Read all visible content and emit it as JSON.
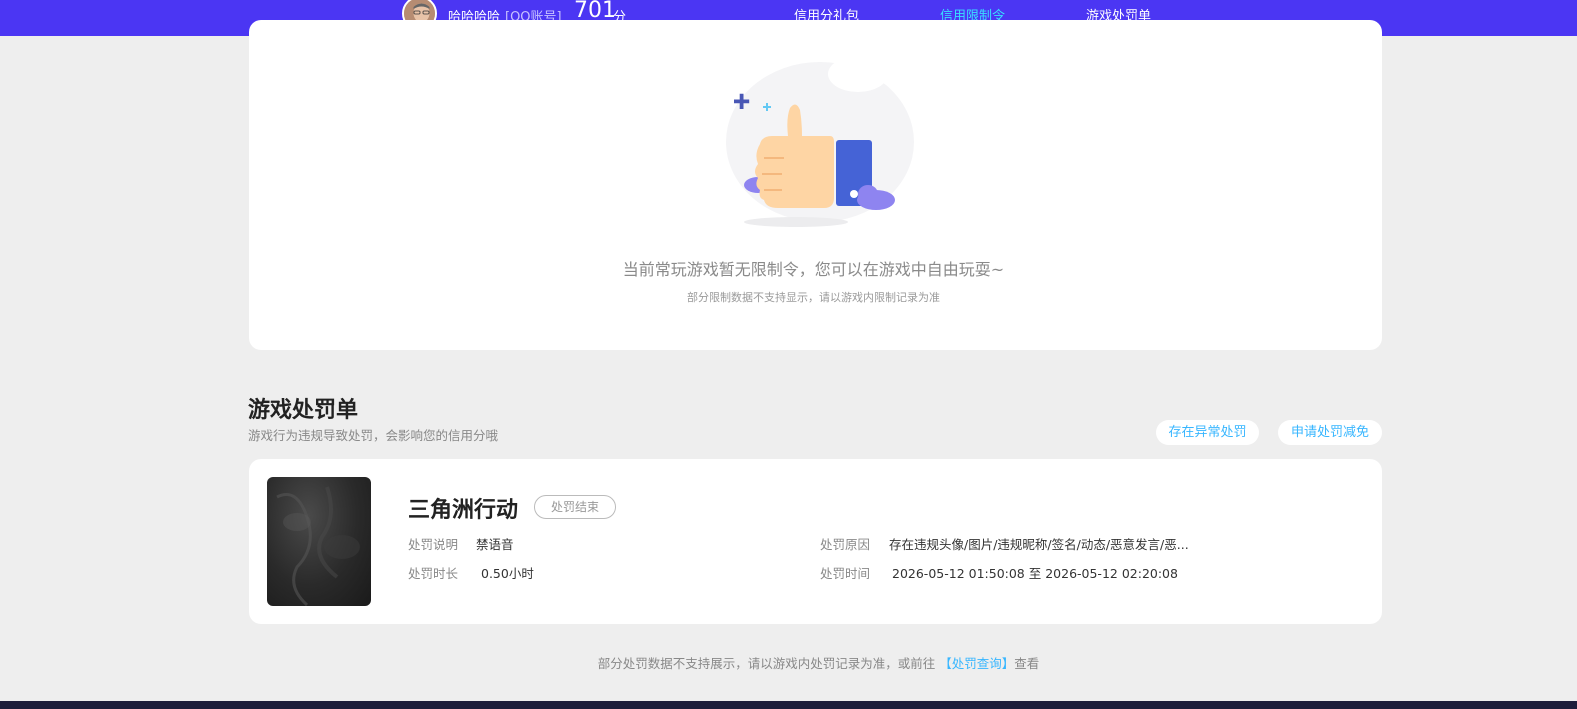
{
  "header": {
    "username": "哈哈哈哈",
    "account_type": "[QQ账号]",
    "score": "701",
    "score_unit": "分",
    "nav": [
      {
        "label": "信用分礼包",
        "active": false
      },
      {
        "label": "信用限制令",
        "active": true
      },
      {
        "label": "游戏处罚单",
        "active": false
      }
    ],
    "accent_color": "#4b36f3",
    "active_color": "#39e0ff"
  },
  "restriction": {
    "empty_title": "当前常玩游戏暂无限制令，您可以在游戏中自由玩耍~",
    "empty_sub": "部分限制数据不支持显示，请以游戏内限制记录为准",
    "illustration_icon": "thumbs-up-icon"
  },
  "penalty": {
    "title": "游戏处罚单",
    "subtitle": "游戏行为违规导致处罚，会影响您的信用分哦",
    "buttons": {
      "abnormal": "存在异常处罚",
      "appeal": "申请处罚减免"
    },
    "items": [
      {
        "game": "三角洲行动",
        "status": "处罚结束",
        "desc_label": "处罚说明",
        "desc_value": "禁语音",
        "duration_label": "处罚时长",
        "duration_value": "0.50小时",
        "reason_label": "处罚原因",
        "reason_value": "存在违规头像/图片/违规昵称/签名/动态/恶意发言/恶...",
        "time_label": "处罚时间",
        "time_value": "2026-05-12 01:50:08 至 2026-05-12 02:20:08"
      }
    ]
  },
  "footer": {
    "note_prefix": "部分处罚数据不支持展示，请以游戏内处罚记录为准，或前往",
    "link_text": "【处罚查询】",
    "note_suffix": "查看"
  }
}
